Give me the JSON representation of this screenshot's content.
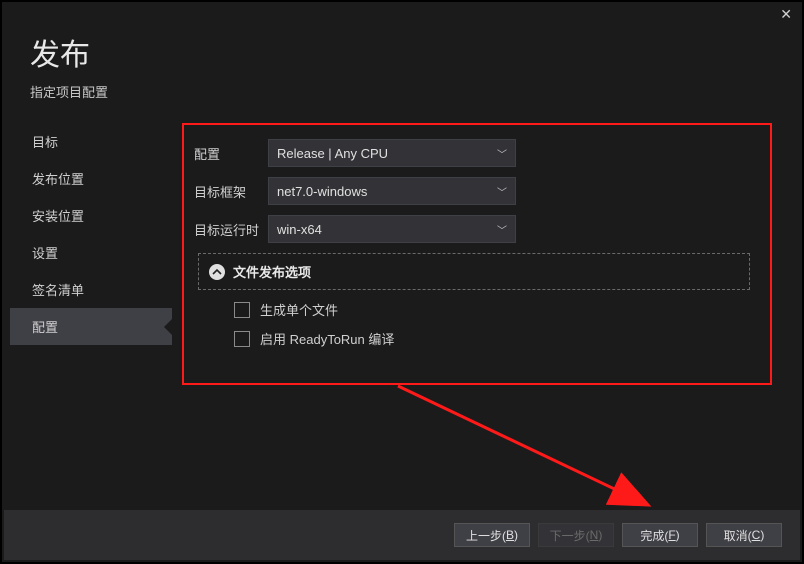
{
  "header": {
    "title": "发布",
    "subtitle": "指定项目配置"
  },
  "sidebar": {
    "items": [
      {
        "label": "目标"
      },
      {
        "label": "发布位置"
      },
      {
        "label": "安装位置"
      },
      {
        "label": "设置"
      },
      {
        "label": "签名清单"
      },
      {
        "label": "配置"
      }
    ],
    "activeIndex": 5
  },
  "form": {
    "config_label": "配置",
    "config_value": "Release | Any CPU",
    "framework_label": "目标框架",
    "framework_value": "net7.0-windows",
    "runtime_label": "目标运行时",
    "runtime_value": "win-x64"
  },
  "expander": {
    "label": "文件发布选项"
  },
  "checks": {
    "single_file": "生成单个文件",
    "ready_to_run": "启用 ReadyToRun 编译"
  },
  "footer": {
    "back_pre": "上一步(",
    "back_key": "B",
    "back_post": ")",
    "next_pre": "下一步(",
    "next_key": "N",
    "next_post": ")",
    "finish_pre": "完成(",
    "finish_key": "F",
    "finish_post": ")",
    "cancel_pre": "取消(",
    "cancel_key": "C",
    "cancel_post": ")"
  }
}
